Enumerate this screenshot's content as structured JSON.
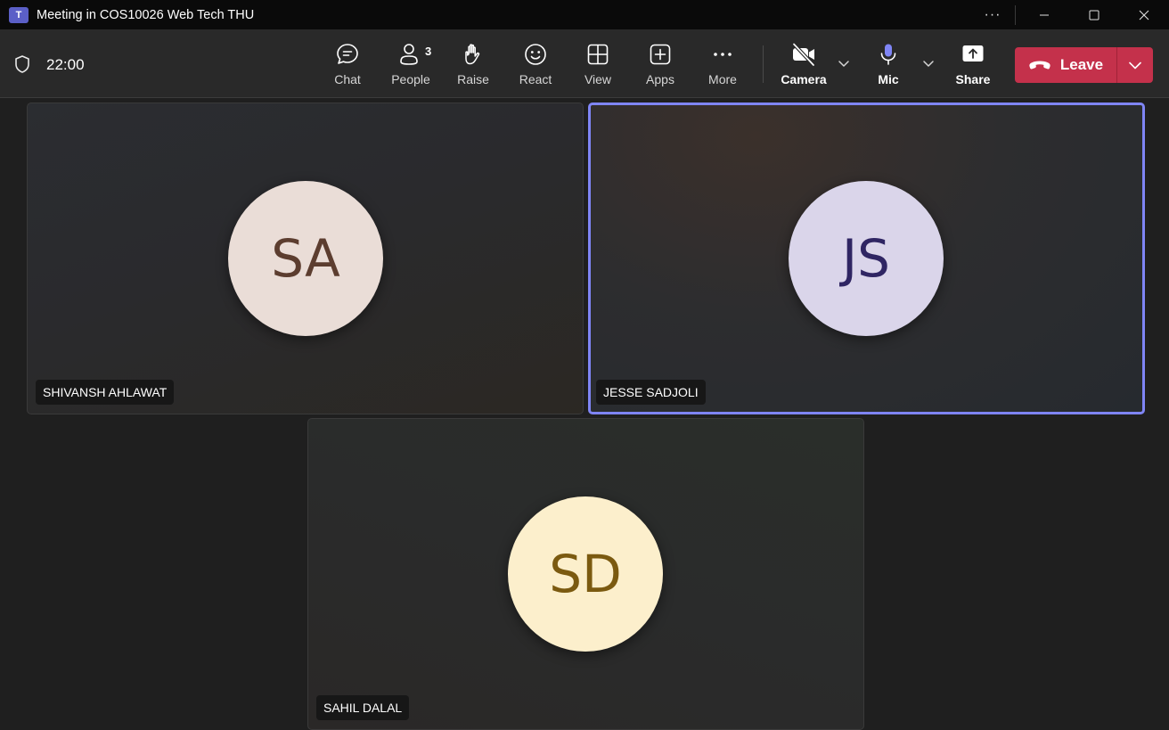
{
  "window": {
    "title": "Meeting in COS10026 Web Tech THU",
    "controls": [
      "more-icon",
      "minimize-icon",
      "maximize-icon",
      "close-icon"
    ]
  },
  "toolbar": {
    "timer": "22:00",
    "buttons": {
      "chat": "Chat",
      "people": "People",
      "people_count": "3",
      "raise": "Raise",
      "react": "React",
      "view": "View",
      "apps": "Apps",
      "more": "More",
      "camera": "Camera",
      "mic": "Mic",
      "share": "Share",
      "leave": "Leave"
    },
    "colors": {
      "leave": "#c4314b",
      "accent": "#7f85f5"
    }
  },
  "participants": [
    {
      "initials": "SA",
      "name": "SHIVANSH AHLAWAT",
      "avatar_bg": "#eaddd7",
      "avatar_fg": "#5c3d2f",
      "speaking": false
    },
    {
      "initials": "JS",
      "name": "JESSE SADJOLI",
      "avatar_bg": "#dad5ea",
      "avatar_fg": "#2f2563",
      "speaking": true
    },
    {
      "initials": "SD",
      "name": "SAHIL DALAL",
      "avatar_bg": "#fcefcc",
      "avatar_fg": "#7b5a10",
      "speaking": false
    }
  ]
}
